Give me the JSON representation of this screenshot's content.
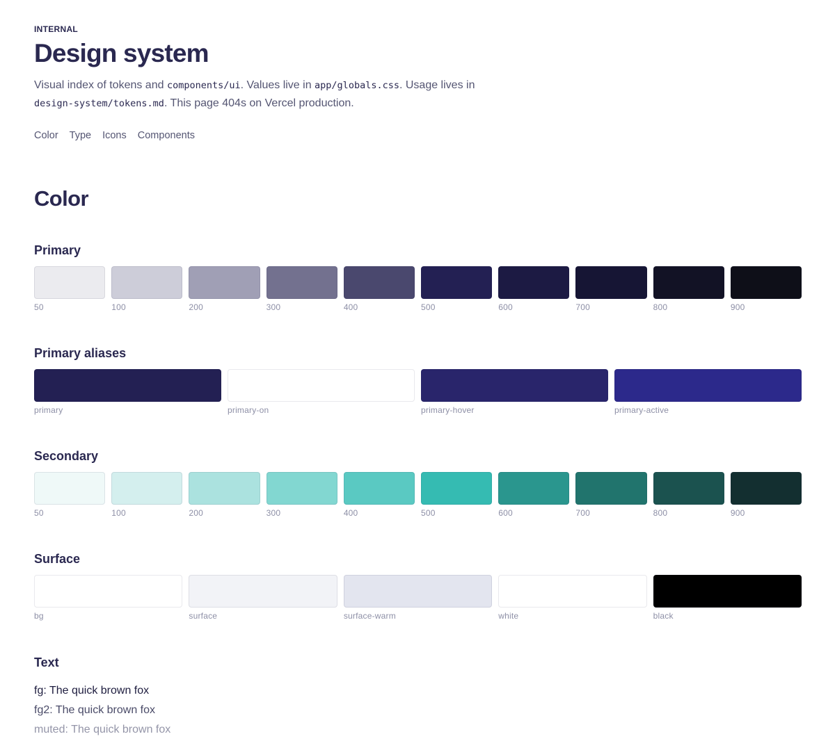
{
  "header": {
    "eyebrow": "INTERNAL",
    "title": "Design system",
    "intro": {
      "p1": "Visual index of tokens and ",
      "code1": "components/ui",
      "p2": ". Values live in ",
      "code2": "app/globals.css",
      "p3": ". Usage lives in ",
      "code3": "design-system/tokens.md",
      "p4": ". This page 404s on Vercel production."
    },
    "nav": [
      "Color",
      "Type",
      "Icons",
      "Components"
    ]
  },
  "color": {
    "heading": "Color",
    "primary": {
      "title": "Primary",
      "swatches": [
        {
          "label": "50",
          "color": "#ebebef"
        },
        {
          "label": "100",
          "color": "#cdcdd9"
        },
        {
          "label": "200",
          "color": "#a09fb5"
        },
        {
          "label": "300",
          "color": "#73718f"
        },
        {
          "label": "400",
          "color": "#4a486e"
        },
        {
          "label": "500",
          "color": "#232053"
        },
        {
          "label": "600",
          "color": "#1c1a43"
        },
        {
          "label": "700",
          "color": "#161534"
        },
        {
          "label": "800",
          "color": "#121225"
        },
        {
          "label": "900",
          "color": "#0e0f18"
        }
      ]
    },
    "aliases": {
      "title": "Primary aliases",
      "swatches": [
        {
          "label": "primary",
          "color": "#232053"
        },
        {
          "label": "primary-on",
          "color": "#ffffff"
        },
        {
          "label": "primary-hover",
          "color": "#29256b"
        },
        {
          "label": "primary-active",
          "color": "#2c298b"
        }
      ]
    },
    "secondary": {
      "title": "Secondary",
      "swatches": [
        {
          "label": "50",
          "color": "#eff9f8"
        },
        {
          "label": "100",
          "color": "#d4efee"
        },
        {
          "label": "200",
          "color": "#abe2df"
        },
        {
          "label": "300",
          "color": "#82d7d1"
        },
        {
          "label": "400",
          "color": "#5ac9c2"
        },
        {
          "label": "500",
          "color": "#35bbb2"
        },
        {
          "label": "600",
          "color": "#2a968e"
        },
        {
          "label": "700",
          "color": "#21746d"
        },
        {
          "label": "800",
          "color": "#1b524f"
        },
        {
          "label": "900",
          "color": "#132f30"
        }
      ]
    },
    "surface": {
      "title": "Surface",
      "swatches": [
        {
          "label": "bg",
          "color": "#ffffff"
        },
        {
          "label": "surface",
          "color": "#f2f3f7"
        },
        {
          "label": "surface-warm",
          "color": "#e3e5ef"
        },
        {
          "label": "white",
          "color": "#ffffff"
        },
        {
          "label": "black",
          "color": "#000000"
        }
      ]
    },
    "text": {
      "title": "Text",
      "samples": [
        {
          "label": "fg: The quick brown fox",
          "color": "#1e1d3f"
        },
        {
          "label": "fg2: The quick brown fox",
          "color": "#4a4b68"
        },
        {
          "label": "muted: The quick brown fox",
          "color": "#9495a8"
        }
      ]
    }
  }
}
